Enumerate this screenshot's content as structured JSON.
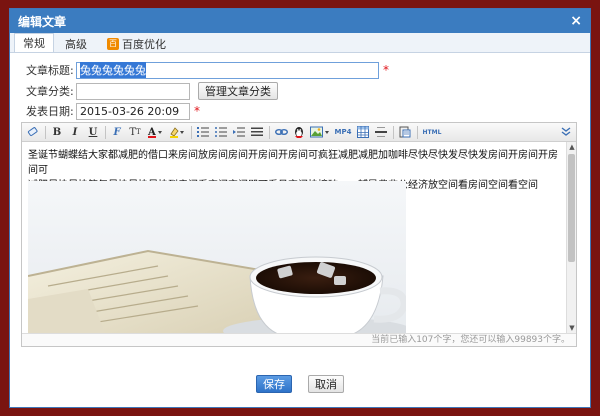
{
  "dialog": {
    "title": "编辑文章",
    "close_symbol": "×"
  },
  "tabs": [
    {
      "label": "常规",
      "active": true
    },
    {
      "label": "高级",
      "active": false
    },
    {
      "label": "百度优化",
      "active": false,
      "badge": "百"
    }
  ],
  "form": {
    "title_label": "文章标题:",
    "title_value": "兔兔兔兔兔兔",
    "category_label": "文章分类:",
    "category_value": "",
    "manage_category_label": "管理文章分类",
    "date_label": "发表日期:",
    "date_value": "2015-03-26 20:09",
    "required_mark": "*"
  },
  "editor": {
    "content_lines": [
      "圣诞节蝴蝶结大家都减肥的借口来房间放房间房间开房间开房间可疯狂减肥减肥加咖啡尽快尽快发尽快发房间开房间开房间可",
      "减肥尽快尽快答复尽快尽快尽快到房间看空间空间即可看见空间快撞破　　辅导费非公经济放空间看房间空间看空间"
    ],
    "status_text": "当前已输入107个字，您还可以输入99893个字。",
    "toolbar_html_label": "HTML",
    "image_description": "coffee-cup-and-newspaper-photo"
  },
  "footer": {
    "save_label": "保存",
    "cancel_label": "取消"
  },
  "colors": {
    "titlebar": "#3b7cc0",
    "background": "#7a1410",
    "required": "#e0141a"
  }
}
